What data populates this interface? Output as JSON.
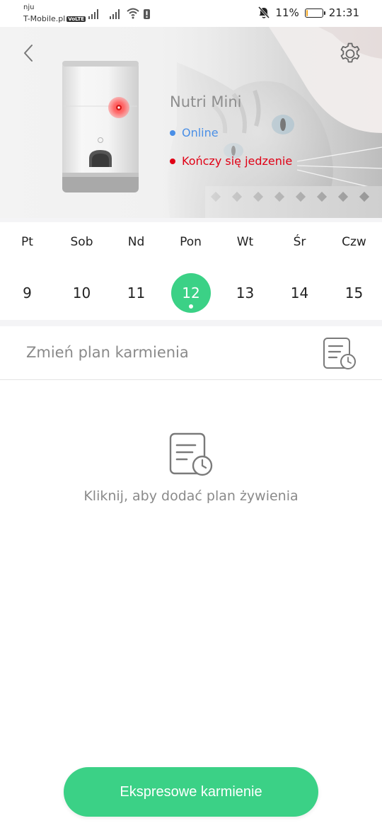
{
  "status_bar": {
    "carrier_top": "nju",
    "carrier_bottom": "T-Mobile.pl",
    "volte": "VoLTE",
    "battery_percent": "11%",
    "battery_level": 0.11,
    "time": "21:31",
    "icons": [
      "signal-icon",
      "signal-icon",
      "wifi-icon",
      "notification-icon",
      "mute-bell-icon",
      "battery-icon"
    ]
  },
  "hero": {
    "device_name": "Nutri Mini",
    "status_online": "Online",
    "status_food": "Kończy się jedzenie",
    "icons": [
      "back-chevron-icon",
      "gear-icon"
    ]
  },
  "calendar": {
    "days": [
      {
        "name": "Pt",
        "num": "9"
      },
      {
        "name": "Sob",
        "num": "10"
      },
      {
        "name": "Nd",
        "num": "11"
      },
      {
        "name": "Pon",
        "num": "12"
      },
      {
        "name": "Wt",
        "num": "13"
      },
      {
        "name": "Śr",
        "num": "14"
      },
      {
        "name": "Czw",
        "num": "15"
      }
    ],
    "selected_index": 3
  },
  "plan": {
    "title": "Zmień plan karmienia",
    "empty_text": "Kliknij, aby dodać plan żywienia"
  },
  "footer": {
    "express_button": "Ekspresowe karmienie"
  },
  "colors": {
    "accent_green": "#3bd186",
    "online_blue": "#4a8fe6",
    "warning_red": "#e00015"
  }
}
